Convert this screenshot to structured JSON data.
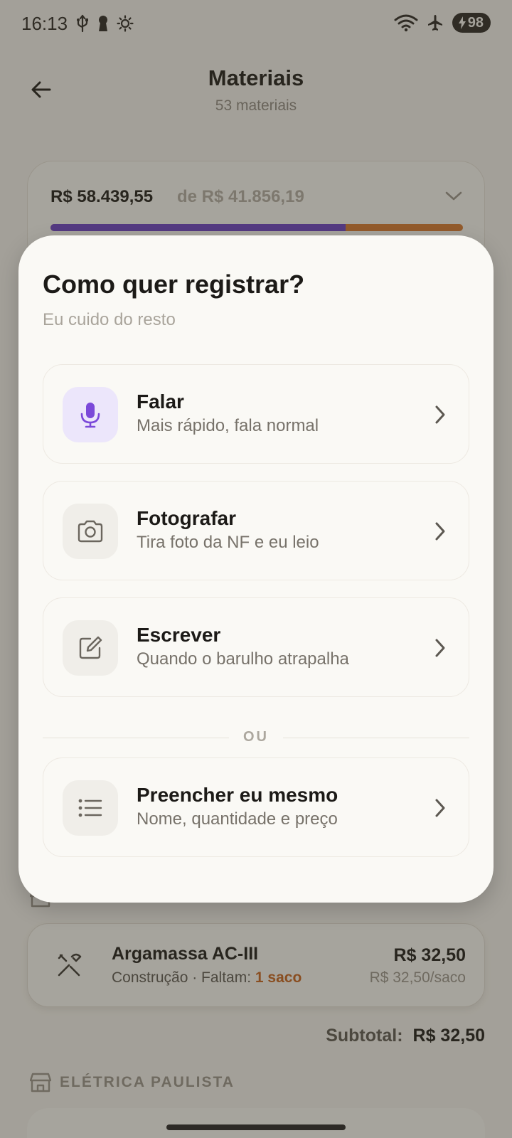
{
  "status_bar": {
    "time": "16:13",
    "left_icons": [
      "usb-icon",
      "keyhole-icon",
      "brightness-icon"
    ],
    "right_icons": [
      "wifi-icon",
      "airplane-icon"
    ],
    "battery": "98"
  },
  "header": {
    "title": "Materiais",
    "subtitle": "53 materiais"
  },
  "budget": {
    "spent": "R$ 58.439,55",
    "total": "de R$ 41.856,19",
    "progress_fraction": 0.715,
    "colors": {
      "fill": "#6a3fc8",
      "over": "#d97a2f"
    }
  },
  "sheet": {
    "title": "Como quer registrar?",
    "subtitle": "Eu cuido do resto",
    "options": [
      {
        "title": "Falar",
        "desc": "Mais rápido, fala normal",
        "icon": "microphone-icon"
      },
      {
        "title": "Fotografar",
        "desc": "Tira foto da NF e eu leio",
        "icon": "camera-icon"
      },
      {
        "title": "Escrever",
        "desc": "Quando o barulho atrapalha",
        "icon": "edit-icon"
      }
    ],
    "divider": "OU",
    "manual_option": {
      "title": "Preencher eu mesmo",
      "desc": "Nome, quantidade e preço",
      "icon": "list-icon"
    }
  },
  "material": {
    "name": "Argamassa AC-III",
    "category": "Construção · Faltam: ",
    "missing": "1 saco",
    "price": "R$ 32,50",
    "unit_price": "R$ 32,50/saco",
    "icon": "tools-icon"
  },
  "subtotal": {
    "label": "Subtotal:",
    "value": "R$ 32,50"
  },
  "store": {
    "name": "ELÉTRICA PAULISTA",
    "icon": "store-icon"
  }
}
